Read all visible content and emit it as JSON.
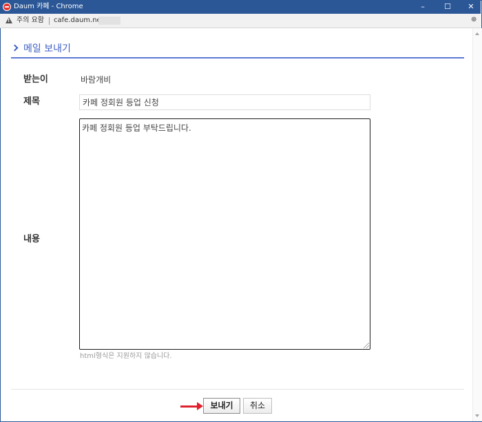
{
  "window": {
    "title": "Daum 카페 - Chrome",
    "minimize_icon": "minimize-icon",
    "maximize_icon": "maximize-icon",
    "close_icon": "close-icon"
  },
  "addressbar": {
    "security_label": "주의 요함",
    "url": "cafe.daum.net/"
  },
  "page": {
    "title": "메일 보내기"
  },
  "form": {
    "recipient_label": "받는이",
    "recipient_value": "바람개비",
    "subject_label": "제목",
    "subject_value": "카페 정회원 등업 신청",
    "content_label": "내용",
    "content_value": "카페 정회원 등업 부탁드립니다.",
    "hint": "html형식은 지원하지 않습니다."
  },
  "buttons": {
    "send": "보내기",
    "cancel": "취소"
  },
  "colors": {
    "titlebar": "#2b5797",
    "accent": "#3f60c2",
    "arrow": "#e0202c"
  }
}
